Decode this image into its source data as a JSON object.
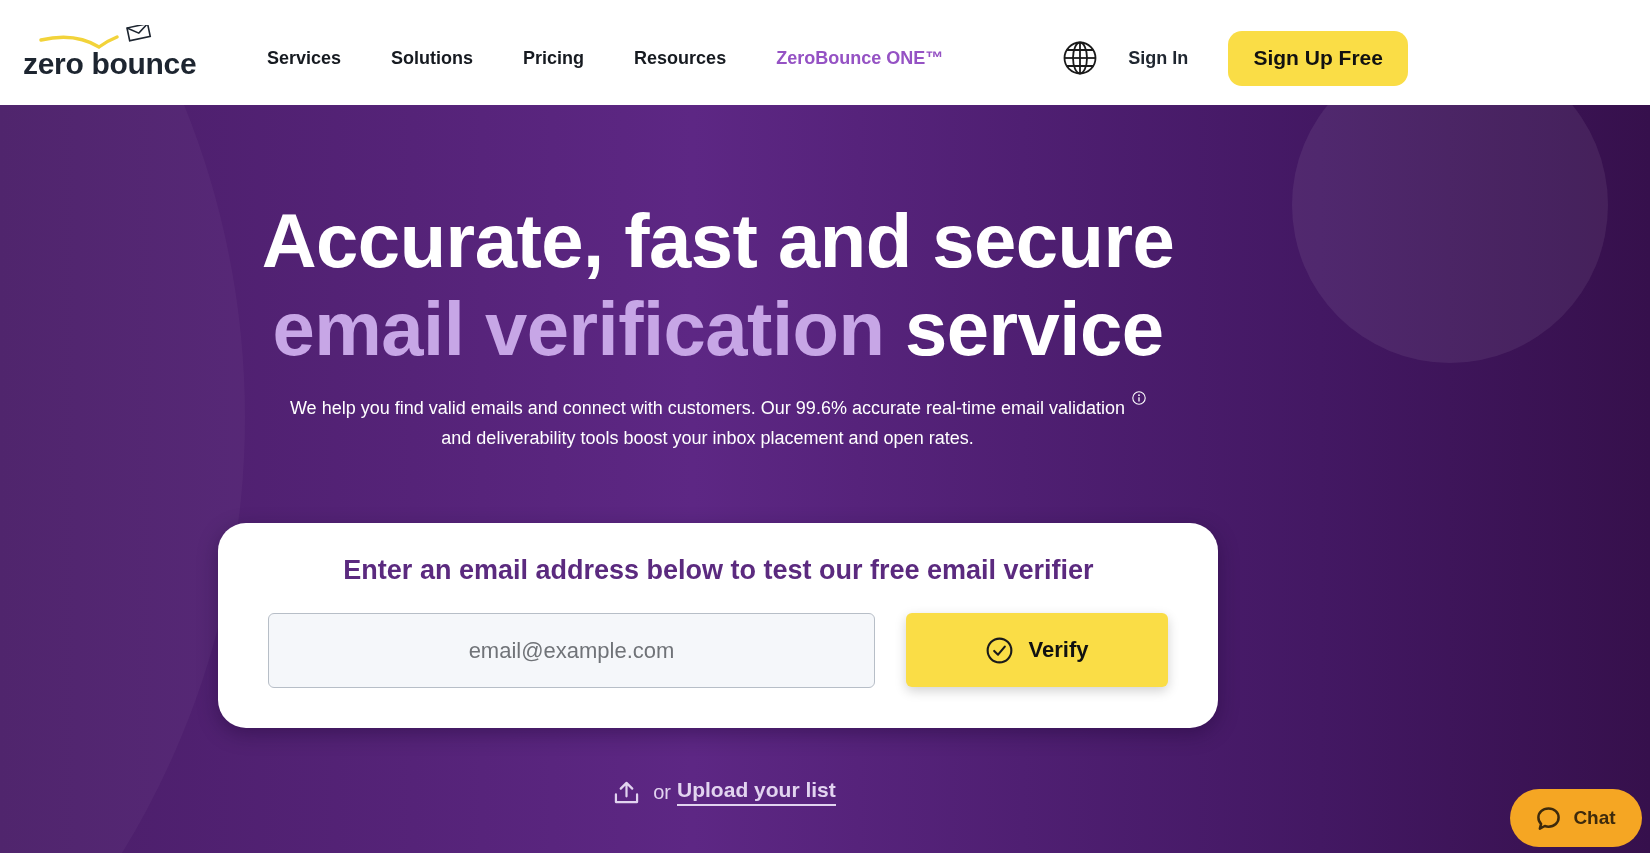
{
  "header": {
    "logo": "zero bounce",
    "nav": [
      {
        "label": "Services",
        "kind": "link"
      },
      {
        "label": "Solutions",
        "kind": "link"
      },
      {
        "label": "Pricing",
        "kind": "link"
      },
      {
        "label": "Resources",
        "kind": "link"
      },
      {
        "label": "ZeroBounce ONE™",
        "kind": "featured"
      }
    ],
    "sign_in": "Sign In",
    "sign_up": "Sign Up Free"
  },
  "hero": {
    "heading": {
      "line_1": "Accurate, fast and secure",
      "line_2_accent": "email verification",
      "line_2_rest": "service"
    },
    "description_lines": [
      "We help you find valid emails and connect with customers. Our 99.6% accurate real-time email validation",
      "and deliverability tools boost your inbox placement and open rates."
    ]
  },
  "verifier": {
    "title": "Enter an email address below to test our free email verifier",
    "email_field": {
      "placeholder": "email@example.com"
    },
    "verify_button": "Verify"
  },
  "upload": {
    "prefix": "or",
    "link": "Upload your list"
  },
  "chat": {
    "label": "Chat"
  }
}
